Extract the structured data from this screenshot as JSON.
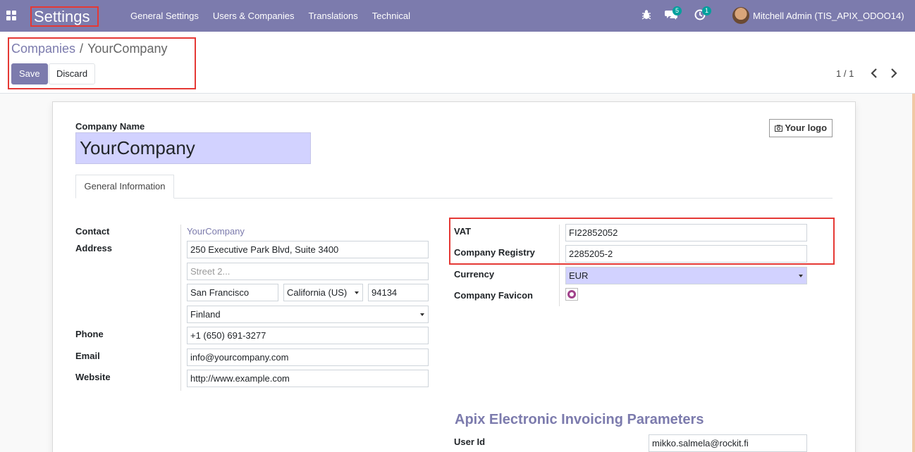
{
  "navbar": {
    "brand": "Settings",
    "menu": [
      "General Settings",
      "Users & Companies",
      "Translations",
      "Technical"
    ],
    "messages_count": "5",
    "activities_count": "1",
    "user": "Mitchell Admin (TIS_APIX_ODOO14)"
  },
  "control_panel": {
    "breadcrumb_parent": "Companies",
    "breadcrumb_separator": "/",
    "breadcrumb_current": "YourCompany",
    "save_label": "Save",
    "discard_label": "Discard",
    "pager": "1 / 1"
  },
  "form": {
    "company_name_label": "Company Name",
    "company_name": "YourCompany",
    "logo_button": "Your logo",
    "tab": "General Information",
    "contact_label": "Contact",
    "contact_value": "YourCompany",
    "address_label": "Address",
    "street": "250 Executive Park Blvd, Suite 3400",
    "street2_placeholder": "Street 2...",
    "city": "San Francisco",
    "state": "California (US)",
    "zip": "94134",
    "country": "Finland",
    "phone_label": "Phone",
    "phone": "+1 (650) 691-3277",
    "email_label": "Email",
    "email": "info@yourcompany.com",
    "website_label": "Website",
    "website": "http://www.example.com",
    "vat_label": "VAT",
    "vat": "FI22852052",
    "registry_label": "Company Registry",
    "registry": "2285205-2",
    "currency_label": "Currency",
    "currency": "EUR",
    "favicon_label": "Company Favicon",
    "apix_title": "Apix Electronic Invoicing Parameters",
    "user_id_label": "User Id",
    "user_id": "mikko.salmela@rockit.fi"
  },
  "colors": {
    "brand": "#7c7bad",
    "required_field": "#d2d2ff",
    "highlight": "#e53935",
    "badge": "#00a09d"
  }
}
